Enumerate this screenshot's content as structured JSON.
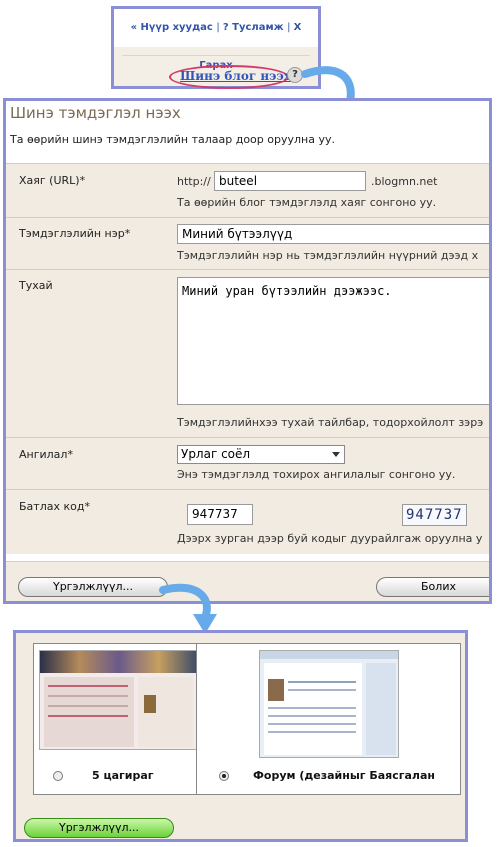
{
  "top_nav": {
    "home": "« Нүүр хуудас",
    "help": "? Тусламж",
    "logout": "X Гарах",
    "new_blog": "Шинэ блог нээх",
    "help_icon": "?"
  },
  "form": {
    "title": "Шинэ тэмдэглэл нээх",
    "intro": "Та өөрийн шинэ тэмдэглэлийн талаар доор оруулна уу.",
    "url": {
      "label": "Хаяг (URL)*",
      "prefix": "http://",
      "value": "buteel",
      "suffix": ".blogmn.net",
      "hint": "Та өөрийн блог тэмдэглэлд хаяг сонгоно уу."
    },
    "name": {
      "label": "Тэмдэглэлийн нэр*",
      "value": "Миний бүтээлүүд",
      "hint": "Тэмдэглэлийн нэр нь тэмдэглэлийн нүүрний дээд х"
    },
    "about": {
      "label": "Тухай",
      "value": "Миний уран бүтээлийн дээжээс.",
      "hint": "Тэмдэглэлийнхээ тухай тайлбар, тодорхойлолт зэрэ"
    },
    "category": {
      "label": "Ангилал*",
      "value": "Урлаг соёл",
      "hint": "Энэ тэмдэглэлд тохирох ангилалыг сонгоно уу."
    },
    "captcha": {
      "label": "Батлах код*",
      "value": "947737",
      "image_text": "947737",
      "hint": "Дээрх зурган дээр буй кодыг дуурайлгаж оруулна у"
    },
    "continue_label": "Үргэлжлүүл...",
    "cancel_label": "Болих"
  },
  "themes": {
    "items": [
      {
        "name": "5 цагираг",
        "selected": false
      },
      {
        "name": "Форум (дезайныг Баясгалан",
        "selected": true
      }
    ],
    "continue_label": "Үргэлжлүүл..."
  },
  "colors": {
    "panel_border": "#8a8fd6",
    "arrow": "#66aaea",
    "highlight_ring": "#d23a6b",
    "link": "#3355aa",
    "form_bg": "#f1ebe1"
  }
}
